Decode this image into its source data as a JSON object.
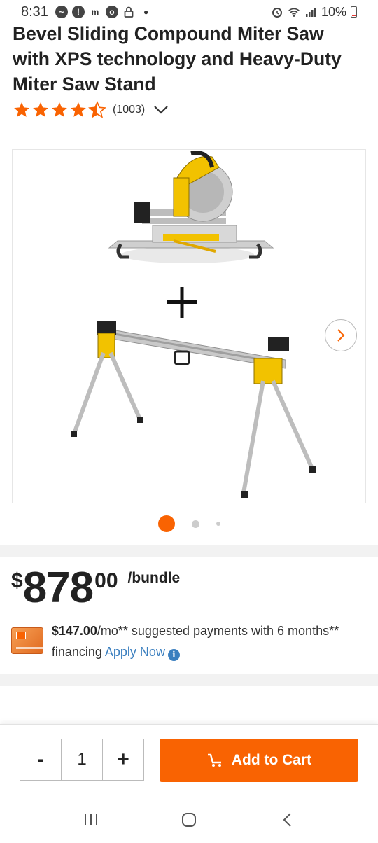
{
  "status_bar": {
    "time": "8:31",
    "left_icons": [
      "messenger-icon",
      "alert-icon",
      "m-zone-icon",
      "chrome-icon",
      "lock-icon"
    ],
    "battery": "10%",
    "right_icons": [
      "alarm-icon",
      "wifi-icon",
      "signal-icon",
      "battery-icon"
    ]
  },
  "product": {
    "title": "Bevel Sliding Compound Miter Saw with XPS technology and Heavy-Duty Miter Saw Stand",
    "rating": 4.5,
    "review_count": "(1003)"
  },
  "carousel": {
    "image_alt": "Miter saw + miter saw stand",
    "dots_total": 3,
    "active_index": 0
  },
  "price": {
    "dollar_sign": "$",
    "main": "878",
    "cents": "00",
    "unit": "/bundle"
  },
  "financing": {
    "amount": "$147.00",
    "text_after": "/mo** suggested payments with 6 months** financing",
    "link": "Apply Now",
    "info_icon": "i"
  },
  "cart": {
    "minus": "-",
    "quantity": "1",
    "plus": "+",
    "add_label": "Add to Cart"
  },
  "colors": {
    "brand_orange": "#f96302",
    "link_blue": "#3b7fbf"
  },
  "nav": [
    "recent-apps-icon",
    "home-icon",
    "back-icon"
  ]
}
